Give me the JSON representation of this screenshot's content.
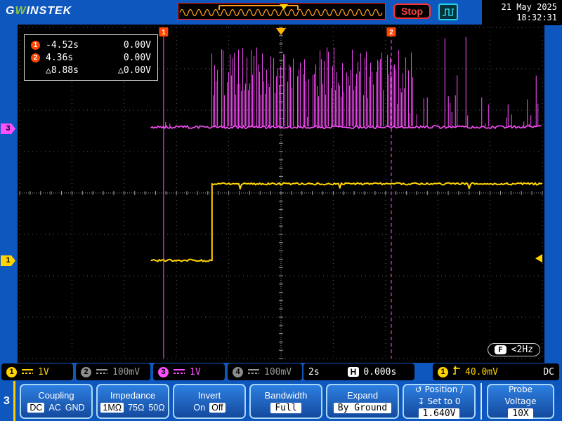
{
  "header": {
    "logo": {
      "g": "G",
      "w": "W",
      "rest": "INSTEK"
    },
    "run_state": "Stop",
    "date": "21 May 2025",
    "time": "18:32:31"
  },
  "cursor_readout": {
    "rows": [
      {
        "marker": "1",
        "time": "-4.52s",
        "volt": "0.00V"
      },
      {
        "marker": "2",
        "time": "4.36s",
        "volt": "0.00V"
      },
      {
        "marker": "",
        "time": "△8.88s",
        "volt": "△0.00V"
      }
    ]
  },
  "freq_readout": {
    "badge": "F",
    "value": "<2Hz"
  },
  "plot": {
    "cursor1_label": "1",
    "cursor2_label": "2",
    "ch3_marker": "3",
    "ch1_marker": "1"
  },
  "status_bar": {
    "channels": [
      {
        "num": "1",
        "scale": "1V"
      },
      {
        "num": "2",
        "scale": "100mV"
      },
      {
        "num": "3",
        "scale": "1V"
      },
      {
        "num": "4",
        "scale": "100mV"
      }
    ],
    "timebase": "2s",
    "h_badge": "H",
    "h_position": "0.000s",
    "trigger": {
      "source": "1",
      "level": "40.0mV",
      "coupling": "DC"
    }
  },
  "menu": {
    "page": "3",
    "coupling": {
      "title": "Coupling",
      "options": [
        "DC",
        "AC",
        "GND"
      ],
      "selected": "DC"
    },
    "impedance": {
      "title": "Impedance",
      "options": [
        "1MΩ",
        "75Ω",
        "50Ω"
      ],
      "selected": "1MΩ"
    },
    "invert": {
      "title": "Invert",
      "options": [
        "On",
        "Off"
      ],
      "selected": "Off"
    },
    "bandwidth": {
      "title": "Bandwidth",
      "value": "Full"
    },
    "expand": {
      "title": "Expand",
      "value": "By Ground"
    },
    "position": {
      "icon1": "↺",
      "line1": "Position /",
      "icon2": "↧",
      "line2": "Set to 0",
      "value": "1.640V"
    },
    "probe": {
      "title_line1": "Probe",
      "title_line2": "Voltage",
      "value": "10X"
    }
  },
  "scope": {
    "hdivs": 10,
    "vdivs": 8,
    "cursor1_x_div": 2.754,
    "cursor2_x_div": 7.11,
    "trigger_x_div": 5,
    "trigger_marker_div_y": 5.58,
    "ch1": {
      "color": "#ffd400",
      "start_div": 2.51,
      "step_div": 3.68,
      "low_div_y": 5.63,
      "high_div_y": 3.78
    },
    "ch3": {
      "color": "#ff4fff",
      "start_div": 2.51,
      "base_div_y": 2.41,
      "burst_start_div": 3.65,
      "burst_end_div": 7.53,
      "top_div_y": 0.44
    }
  }
}
